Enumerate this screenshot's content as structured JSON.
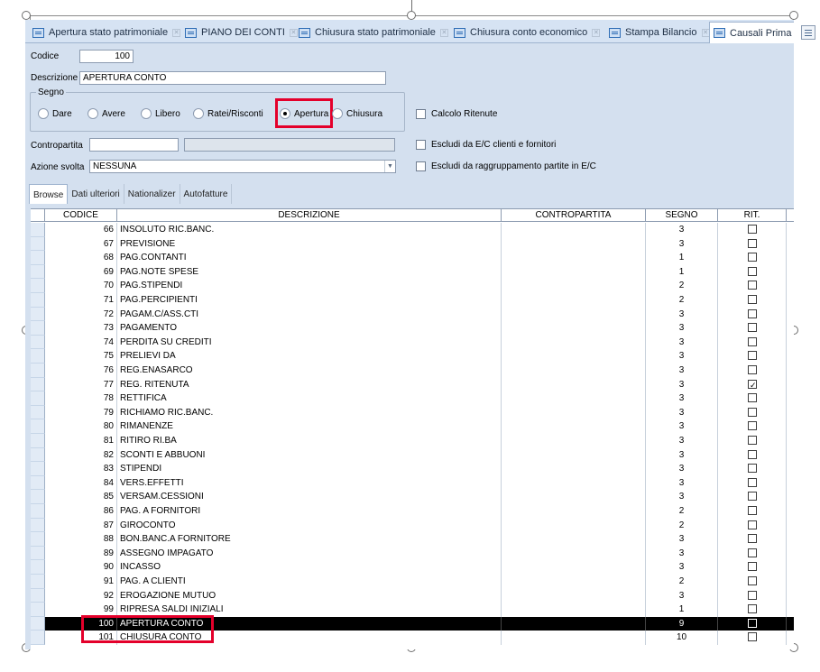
{
  "tabs": [
    {
      "label": "Apertura stato patrimoniale",
      "active": false
    },
    {
      "label": "PIANO DEI CONTI",
      "active": false
    },
    {
      "label": "Chiusura stato patrimoniale",
      "active": false
    },
    {
      "label": "Chiusura conto economico",
      "active": false
    },
    {
      "label": "Stampa Bilancio",
      "active": false
    },
    {
      "label": "Causali Prima",
      "active": true
    }
  ],
  "form": {
    "codice_label": "Codice",
    "codice_value": "100",
    "descrizione_label": "Descrizione",
    "descrizione_value": "APERTURA CONTO",
    "segno_label": "Segno",
    "segno_options": [
      "Dare",
      "Avere",
      "Libero",
      "Ratei/Risconti",
      "Apertura",
      "Chiusura"
    ],
    "segno_selected": "Apertura",
    "calcolo_ritenute_label": "Calcolo Ritenute",
    "contropartita_label": "Contropartita",
    "contropartita_value": "",
    "contropartita_desc": "",
    "escludi_ec_label": "Escludi da E/C clienti e fornitori",
    "azione_label": "Azione svolta",
    "azione_value": "NESSUNA",
    "escludi_raggr_label": "Escludi da raggruppamento partite in E/C"
  },
  "subtabs": [
    "Browse",
    "Dati ulteriori",
    "Nationalizer",
    "Autofatture"
  ],
  "grid": {
    "columns": [
      "CODICE",
      "DESCRIZIONE",
      "CONTROPARTITA",
      "SEGNO",
      "RIT."
    ],
    "rows": [
      {
        "codice": "66",
        "descrizione": "INSOLUTO RIC.BANC.",
        "contropartita": "",
        "segno": "3",
        "rit": false
      },
      {
        "codice": "67",
        "descrizione": "PREVISIONE",
        "contropartita": "",
        "segno": "3",
        "rit": false
      },
      {
        "codice": "68",
        "descrizione": "PAG.CONTANTI",
        "contropartita": "",
        "segno": "1",
        "rit": false
      },
      {
        "codice": "69",
        "descrizione": "PAG.NOTE SPESE",
        "contropartita": "",
        "segno": "1",
        "rit": false
      },
      {
        "codice": "70",
        "descrizione": "PAG.STIPENDI",
        "contropartita": "",
        "segno": "2",
        "rit": false
      },
      {
        "codice": "71",
        "descrizione": "PAG.PERCIPIENTI",
        "contropartita": "",
        "segno": "2",
        "rit": false
      },
      {
        "codice": "72",
        "descrizione": "PAGAM.C/ASS.CTI",
        "contropartita": "",
        "segno": "3",
        "rit": false
      },
      {
        "codice": "73",
        "descrizione": "PAGAMENTO",
        "contropartita": "",
        "segno": "3",
        "rit": false
      },
      {
        "codice": "74",
        "descrizione": "PERDITA SU CREDITI",
        "contropartita": "",
        "segno": "3",
        "rit": false
      },
      {
        "codice": "75",
        "descrizione": "PRELIEVI DA",
        "contropartita": "",
        "segno": "3",
        "rit": false
      },
      {
        "codice": "76",
        "descrizione": "REG.ENASARCO",
        "contropartita": "",
        "segno": "3",
        "rit": false
      },
      {
        "codice": "77",
        "descrizione": "REG. RITENUTA",
        "contropartita": "",
        "segno": "3",
        "rit": true
      },
      {
        "codice": "78",
        "descrizione": "RETTIFICA",
        "contropartita": "",
        "segno": "3",
        "rit": false
      },
      {
        "codice": "79",
        "descrizione": "RICHIAMO RIC.BANC.",
        "contropartita": "",
        "segno": "3",
        "rit": false
      },
      {
        "codice": "80",
        "descrizione": "RIMANENZE",
        "contropartita": "",
        "segno": "3",
        "rit": false
      },
      {
        "codice": "81",
        "descrizione": "RITIRO RI.BA",
        "contropartita": "",
        "segno": "3",
        "rit": false
      },
      {
        "codice": "82",
        "descrizione": "SCONTI E ABBUONI",
        "contropartita": "",
        "segno": "3",
        "rit": false
      },
      {
        "codice": "83",
        "descrizione": "STIPENDI",
        "contropartita": "",
        "segno": "3",
        "rit": false
      },
      {
        "codice": "84",
        "descrizione": "VERS.EFFETTI",
        "contropartita": "",
        "segno": "3",
        "rit": false
      },
      {
        "codice": "85",
        "descrizione": "VERSAM.CESSIONI",
        "contropartita": "",
        "segno": "3",
        "rit": false
      },
      {
        "codice": "86",
        "descrizione": "PAG. A FORNITORI",
        "contropartita": "",
        "segno": "2",
        "rit": false
      },
      {
        "codice": "87",
        "descrizione": "GIROCONTO",
        "contropartita": "",
        "segno": "2",
        "rit": false
      },
      {
        "codice": "88",
        "descrizione": "BON.BANC.A FORNITORE",
        "contropartita": "",
        "segno": "3",
        "rit": false
      },
      {
        "codice": "89",
        "descrizione": "ASSEGNO IMPAGATO",
        "contropartita": "",
        "segno": "3",
        "rit": false
      },
      {
        "codice": "90",
        "descrizione": "INCASSO",
        "contropartita": "",
        "segno": "3",
        "rit": false
      },
      {
        "codice": "91",
        "descrizione": "PAG. A CLIENTI",
        "contropartita": "",
        "segno": "2",
        "rit": false
      },
      {
        "codice": "92",
        "descrizione": "EROGAZIONE MUTUO",
        "contropartita": "",
        "segno": "3",
        "rit": false
      },
      {
        "codice": "99",
        "descrizione": "RIPRESA SALDI INIZIALI",
        "contropartita": "",
        "segno": "1",
        "rit": false
      },
      {
        "codice": "100",
        "descrizione": "APERTURA CONTO",
        "contropartita": "",
        "segno": "9",
        "rit": false,
        "selected": true
      },
      {
        "codice": "101",
        "descrizione": "CHIUSURA CONTO",
        "contropartita": "",
        "segno": "10",
        "rit": false
      }
    ]
  },
  "colors": {
    "highlight": "#e4002b",
    "window_bg": "#d4e0ef",
    "selected_row": "#000000"
  }
}
